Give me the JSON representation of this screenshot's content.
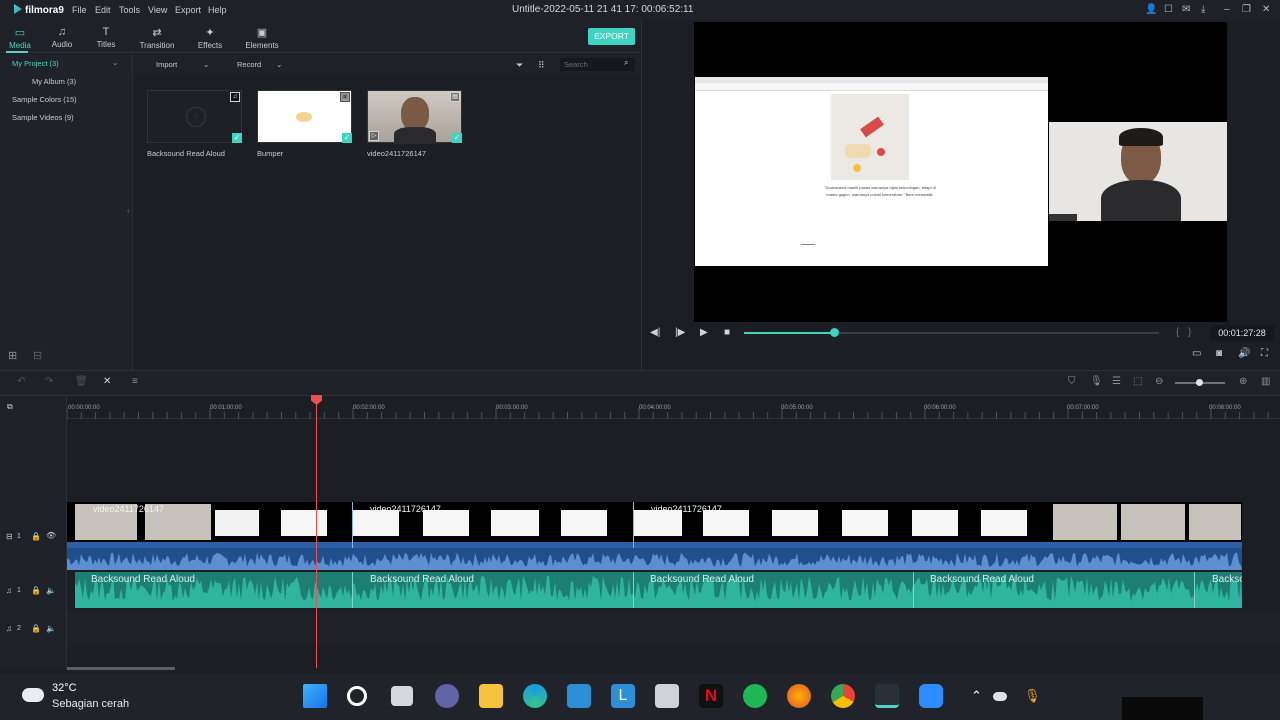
{
  "app": {
    "name": "filmora9",
    "document_title": "Untitle-2022-05-11 21 41 17:  00:06:52:11"
  },
  "menu": [
    "File",
    "Edit",
    "Tools",
    "View",
    "Export",
    "Help"
  ],
  "tabs": [
    {
      "label": "Media",
      "icon": "folder-icon",
      "active": true
    },
    {
      "label": "Audio",
      "icon": "music-note-icon"
    },
    {
      "label": "Titles",
      "icon": "text-icon"
    },
    {
      "label": "Transition",
      "icon": "transition-icon"
    },
    {
      "label": "Effects",
      "icon": "effects-icon"
    },
    {
      "label": "Elements",
      "icon": "image-icon"
    }
  ],
  "export_label": "EXPORT",
  "library": {
    "project": "My Project (3)",
    "album": "My Album (3)",
    "sample_colors": "Sample Colors (15)",
    "sample_videos": "Sample Videos (9)"
  },
  "media_bar": {
    "import": "Import",
    "record": "Record",
    "search_placeholder": "Search"
  },
  "media_items": [
    {
      "label": "Backsound Read Aloud",
      "type": "audio"
    },
    {
      "label": "Bumper",
      "type": "image"
    },
    {
      "label": "video2411726147",
      "type": "video"
    }
  ],
  "preview": {
    "timecode": "00:01:27:28",
    "progress": 0.21,
    "slide_caption_1": "\"Dodoarandi masih panas wamanya hijau kekuningan, tetapi di",
    "slide_caption_2": "mama gagen, warnanya coklat kemerahan.\" Baro membatik."
  },
  "ruler": [
    "00:00:00:00",
    "00:01:00:00",
    "00:02:00:00",
    "00:03:00:00",
    "00:04:00:00",
    "00:05:00:00",
    "00:06:00:00",
    "00:07:00:00",
    "00:08:00:00"
  ],
  "tracks": {
    "video_label": "1",
    "audio1_label": "1",
    "audio2_label": "2",
    "video_clips": [
      "video2411726147",
      "video2411726147",
      "video2411726147"
    ],
    "audio_clips": [
      "Backsound Read Aloud",
      "Backsound Read Aloud",
      "Backsound Read Aloud",
      "Backsound Read Aloud",
      "Backso"
    ]
  },
  "taskbar": {
    "temperature": "32°C",
    "weather": "Sebagian cerah"
  },
  "colors": {
    "accent": "#3fd3c2",
    "playhead": "#f24d4d",
    "video_track": "#2b5fa6",
    "audio_track": "#1d7f73"
  }
}
